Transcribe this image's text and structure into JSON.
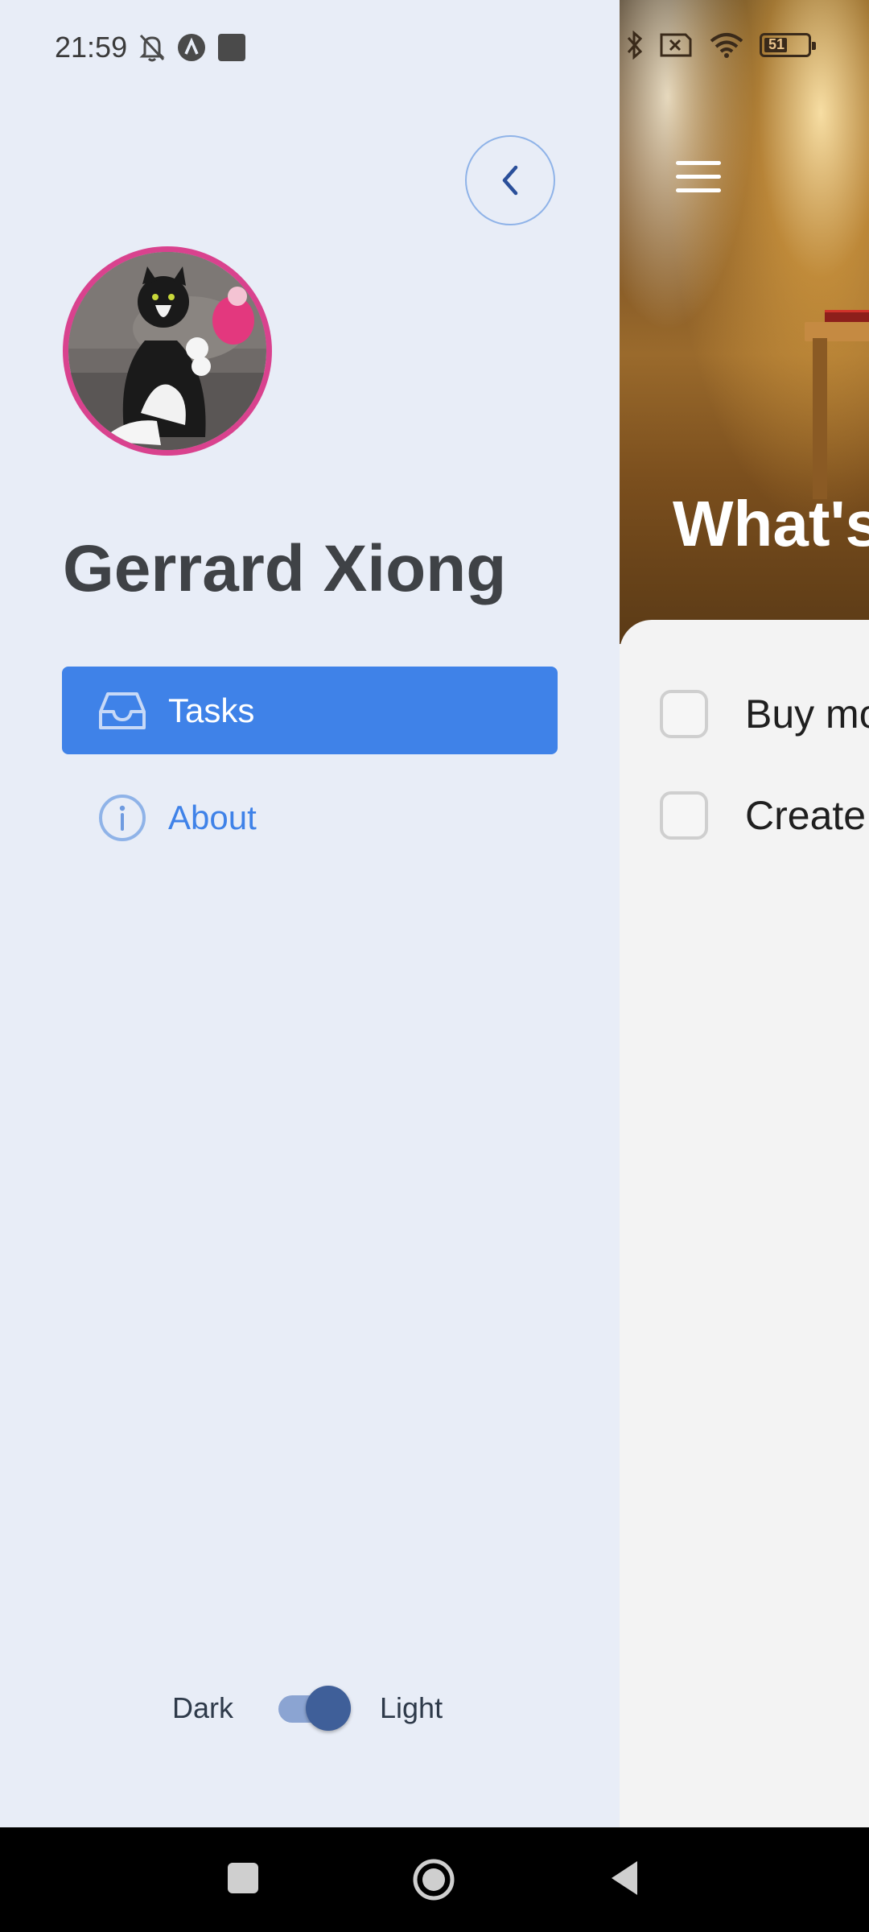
{
  "status_bar": {
    "time": "21:59",
    "icons": [
      "bell-off-icon",
      "app-a-icon",
      "square-app-icon",
      "bluetooth-icon",
      "sim-x-icon",
      "wifi-icon",
      "battery-icon"
    ],
    "battery_level": "51"
  },
  "main": {
    "title": "What's",
    "tasks": [
      {
        "label": "Buy mo",
        "checked": false
      },
      {
        "label": "Create",
        "checked": false
      }
    ]
  },
  "drawer": {
    "profile_name": "Gerrard Xiong",
    "nav": [
      {
        "label": "Tasks",
        "icon": "inbox-icon",
        "active": true
      },
      {
        "label": "About",
        "icon": "info-icon",
        "active": false
      }
    ],
    "theme": {
      "dark_label": "Dark",
      "light_label": "Light",
      "value": "dark"
    }
  },
  "colors": {
    "accent": "#3f82e8",
    "drawer_bg": "#e8edf7",
    "avatar_ring": "#d9428e",
    "switch_thumb": "#3f5f99"
  }
}
